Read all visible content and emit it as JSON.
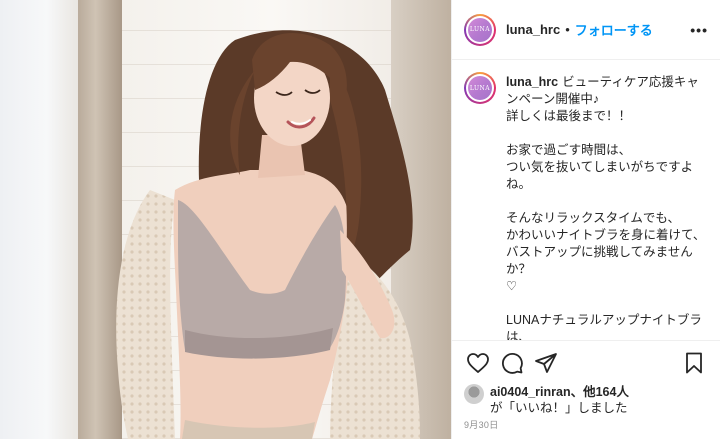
{
  "account": {
    "username": "luna_hrc",
    "separator": "•",
    "follow_label": "フォローする",
    "more_label": "•••",
    "avatar_text": "LUNA"
  },
  "caption": {
    "username": "luna_hrc",
    "text": "ビューティケア応援キャンペーン開催中♪\n詳しくは最後まで！！\n\nお家で過ごす時間は、\nつい気を抜いてしまいがちですよね。\n\nそんなリラックスタイムでも、\nかわいいナイトブラを身に着けて、\nバストアップに挑戦してみませんか？\n♡\n\nLUNAナチュラルアップナイトブラは、\n女性らしいデザインながらも、\nとっても機能的✨\nどんな姿勢でもバストにフィットして、\nワキや背中に流れがちな胸のお肉を"
  },
  "actions": {
    "like_icon": "heart-icon",
    "comment_icon": "comment-icon",
    "share_icon": "share-icon",
    "save_icon": "bookmark-icon"
  },
  "likes": {
    "user": "ai0404_rinran",
    "suffix": "、他164人",
    "line2": "が「いいね！」しました"
  },
  "date": "9月30日",
  "colors": {
    "accent": "#0095f6",
    "text": "#262626",
    "muted": "#8e8e8e",
    "border": "#efefef"
  }
}
